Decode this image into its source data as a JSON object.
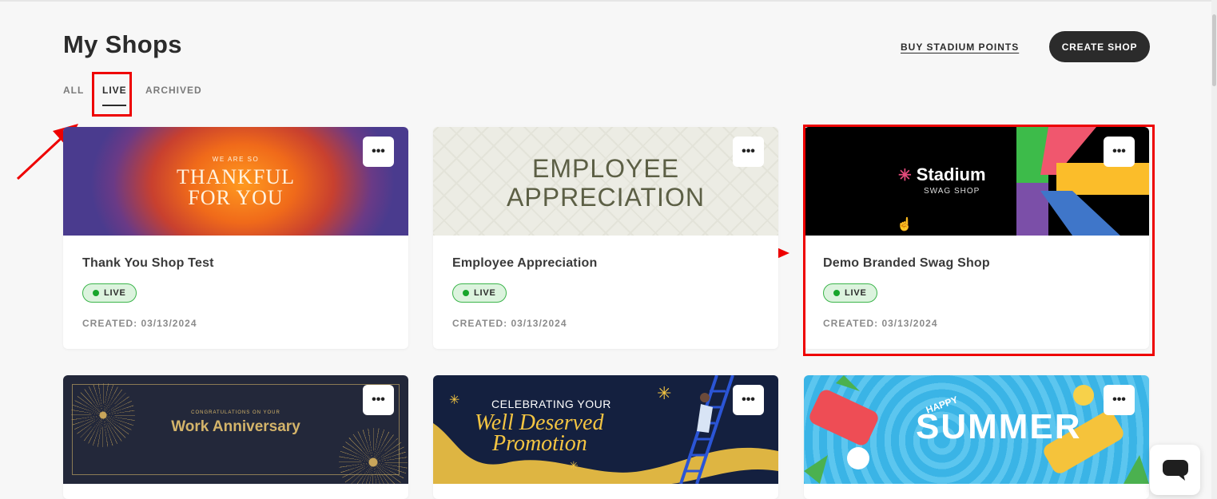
{
  "page": {
    "title": "My Shops",
    "tabs": [
      {
        "label": "ALL"
      },
      {
        "label": "LIVE"
      },
      {
        "label": "ARCHIVED"
      }
    ],
    "active_tab": "LIVE",
    "buy_points_label": "BUY STADIUM POINTS",
    "create_shop_label": "CREATE SHOP"
  },
  "cards": [
    {
      "title": "Thank You Shop Test",
      "status": "LIVE",
      "created": "CREATED: 03/13/2024",
      "banner": {
        "line1": "WE ARE SO",
        "line2": "THANKFUL",
        "line3": "FOR YOU"
      }
    },
    {
      "title": "Employee Appreciation",
      "status": "LIVE",
      "created": "CREATED: 03/13/2024",
      "banner": {
        "line1": "EMPLOYEE",
        "line2": "APPRECIATION"
      }
    },
    {
      "title": "Demo Branded Swag Shop",
      "status": "LIVE",
      "created": "CREATED: 03/13/2024",
      "banner": {
        "brand": "Stadium",
        "sub": "SWAG SHOP"
      }
    },
    {
      "banner": {
        "line1": "CONGRATULATIONS ON YOUR",
        "line2": "Work Anniversary"
      }
    },
    {
      "banner": {
        "line1": "CELEBRATING YOUR",
        "line2": "Well Deserved",
        "line3": "Promotion"
      }
    },
    {
      "banner": {
        "line1": "HAPPY",
        "line2": "SUMMER"
      }
    }
  ],
  "menu_glyph": "•••",
  "colors": {
    "accent_dark": "#2b2b2b",
    "live_green": "#17a52b",
    "highlight_red": "#e00000"
  }
}
